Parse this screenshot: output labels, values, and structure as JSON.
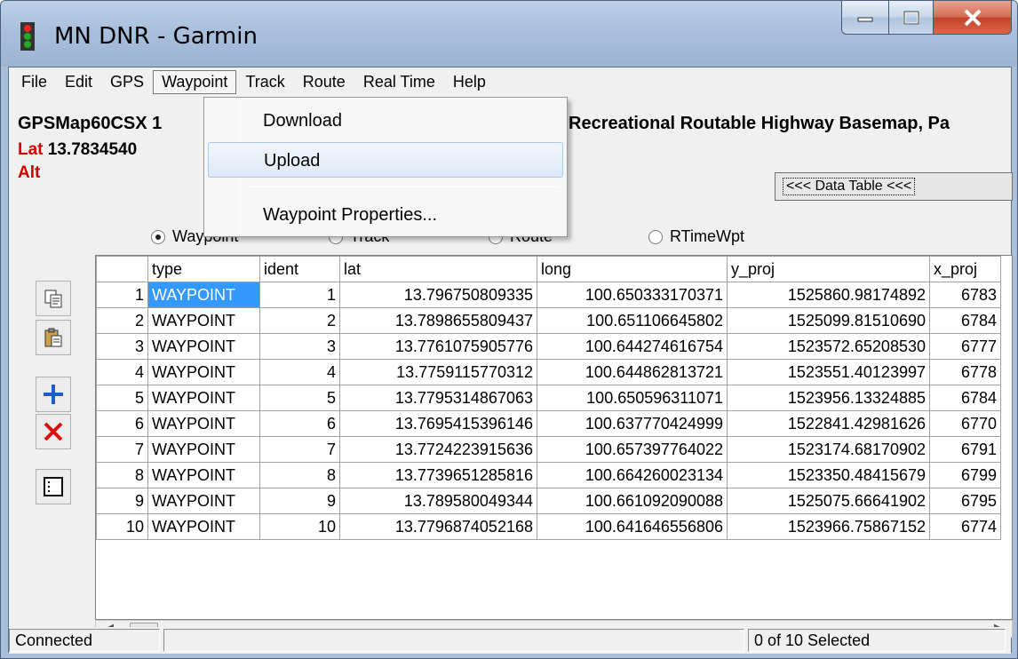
{
  "window": {
    "title": "MN DNR - Garmin"
  },
  "menubar": {
    "items": [
      "File",
      "Edit",
      "GPS",
      "Waypoint",
      "Track",
      "Route",
      "Real Time",
      "Help"
    ]
  },
  "waypoint_menu": {
    "items": [
      "Download",
      "Upload",
      "Waypoint Properties..."
    ],
    "hovered": "Upload"
  },
  "device": {
    "model": "GPSMap60CSX",
    "model_suffix": "1",
    "basemap": "Recreational Routable Highway Basemap, Pa",
    "lat_label": "Lat",
    "lat_value": "13.7834540",
    "alt_label": "Alt"
  },
  "data_table_button": "<<< Data Table <<<",
  "radio_options": [
    {
      "label": "Waypoint",
      "checked": true
    },
    {
      "label": "Track",
      "checked": false
    },
    {
      "label": "Route",
      "checked": false
    },
    {
      "label": "RTimeWpt",
      "checked": false
    }
  ],
  "toolbar": {
    "icons": [
      "copy-icon",
      "paste-icon",
      "add-icon",
      "delete-icon",
      "properties-icon"
    ],
    "colors": {
      "add": "#1a5fc8",
      "delete": "#d81010"
    }
  },
  "grid": {
    "columns": [
      "type",
      "ident",
      "lat",
      "long",
      "y_proj",
      "x_proj"
    ],
    "rows": [
      {
        "n": "1",
        "type": "WAYPOINT",
        "ident": "1",
        "lat": "13.796750809335",
        "long": "100.650333170371",
        "y_proj": "1525860.98174892",
        "x_proj": "6783"
      },
      {
        "n": "2",
        "type": "WAYPOINT",
        "ident": "2",
        "lat": "13.7898655809437",
        "long": "100.651106645802",
        "y_proj": "1525099.81510690",
        "x_proj": "6784"
      },
      {
        "n": "3",
        "type": "WAYPOINT",
        "ident": "3",
        "lat": "13.7761075905776",
        "long": "100.644274616754",
        "y_proj": "1523572.65208530",
        "x_proj": "6777"
      },
      {
        "n": "4",
        "type": "WAYPOINT",
        "ident": "4",
        "lat": "13.7759115770312",
        "long": "100.644862813721",
        "y_proj": "1523551.40123997",
        "x_proj": "6778"
      },
      {
        "n": "5",
        "type": "WAYPOINT",
        "ident": "5",
        "lat": "13.7795314867063",
        "long": "100.650596311071",
        "y_proj": "1523956.13324885",
        "x_proj": "6784"
      },
      {
        "n": "6",
        "type": "WAYPOINT",
        "ident": "6",
        "lat": "13.7695415396146",
        "long": "100.637770424999",
        "y_proj": "1522841.42981626",
        "x_proj": "6770"
      },
      {
        "n": "7",
        "type": "WAYPOINT",
        "ident": "7",
        "lat": "13.7724223915636",
        "long": "100.657397764022",
        "y_proj": "1523174.68170902",
        "x_proj": "6791"
      },
      {
        "n": "8",
        "type": "WAYPOINT",
        "ident": "8",
        "lat": "13.7739651285816",
        "long": "100.664260023134",
        "y_proj": "1523350.48415679",
        "x_proj": "6799"
      },
      {
        "n": "9",
        "type": "WAYPOINT",
        "ident": "9",
        "lat": "13.789580049344",
        "long": "100.661092090088",
        "y_proj": "1525075.66641902",
        "x_proj": "6795"
      },
      {
        "n": "10",
        "type": "WAYPOINT",
        "ident": "10",
        "lat": "13.7796874052168",
        "long": "100.641646556806",
        "y_proj": "1523966.75867152",
        "x_proj": "6774"
      }
    ],
    "selected_cell": {
      "row": 0,
      "col": "type"
    },
    "selection_color": "#3399ff"
  },
  "status": {
    "connection": "Connected",
    "middle": "",
    "selection": "0 of 10 Selected"
  }
}
